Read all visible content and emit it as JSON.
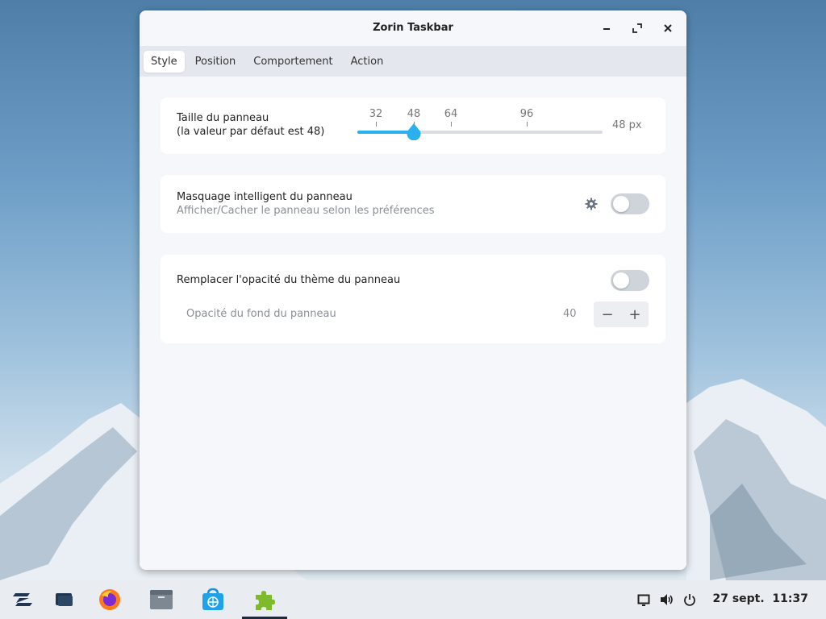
{
  "window": {
    "title": "Zorin Taskbar"
  },
  "tabs": [
    {
      "label": "Style",
      "active": true
    },
    {
      "label": "Position",
      "active": false
    },
    {
      "label": "Comportement",
      "active": false
    },
    {
      "label": "Action",
      "active": false
    }
  ],
  "panel_size": {
    "title": "Taille du panneau",
    "subtitle": "(la valeur par défaut est 48)",
    "marks": [
      "32",
      "48",
      "64",
      "96"
    ],
    "value_label": "48 px",
    "value": 48
  },
  "smart_hide": {
    "title": "Masquage intelligent du panneau",
    "subtitle": "Afficher/Cacher le panneau selon les préférences",
    "enabled": false
  },
  "opacity": {
    "title": "Remplacer l'opacité du thème du panneau",
    "enabled": false,
    "bg_label": "Opacité du fond du panneau",
    "bg_value": "40",
    "minus": "−",
    "plus": "+"
  },
  "taskbar": {
    "clock": "27 sept.  11:37",
    "icons": [
      "zorin-menu-icon",
      "workspace-icon",
      "firefox-icon",
      "files-icon",
      "software-store-icon",
      "extensions-icon"
    ]
  },
  "colors": {
    "accent": "#2ab0ec",
    "toggle_off": "#cfd4db"
  }
}
